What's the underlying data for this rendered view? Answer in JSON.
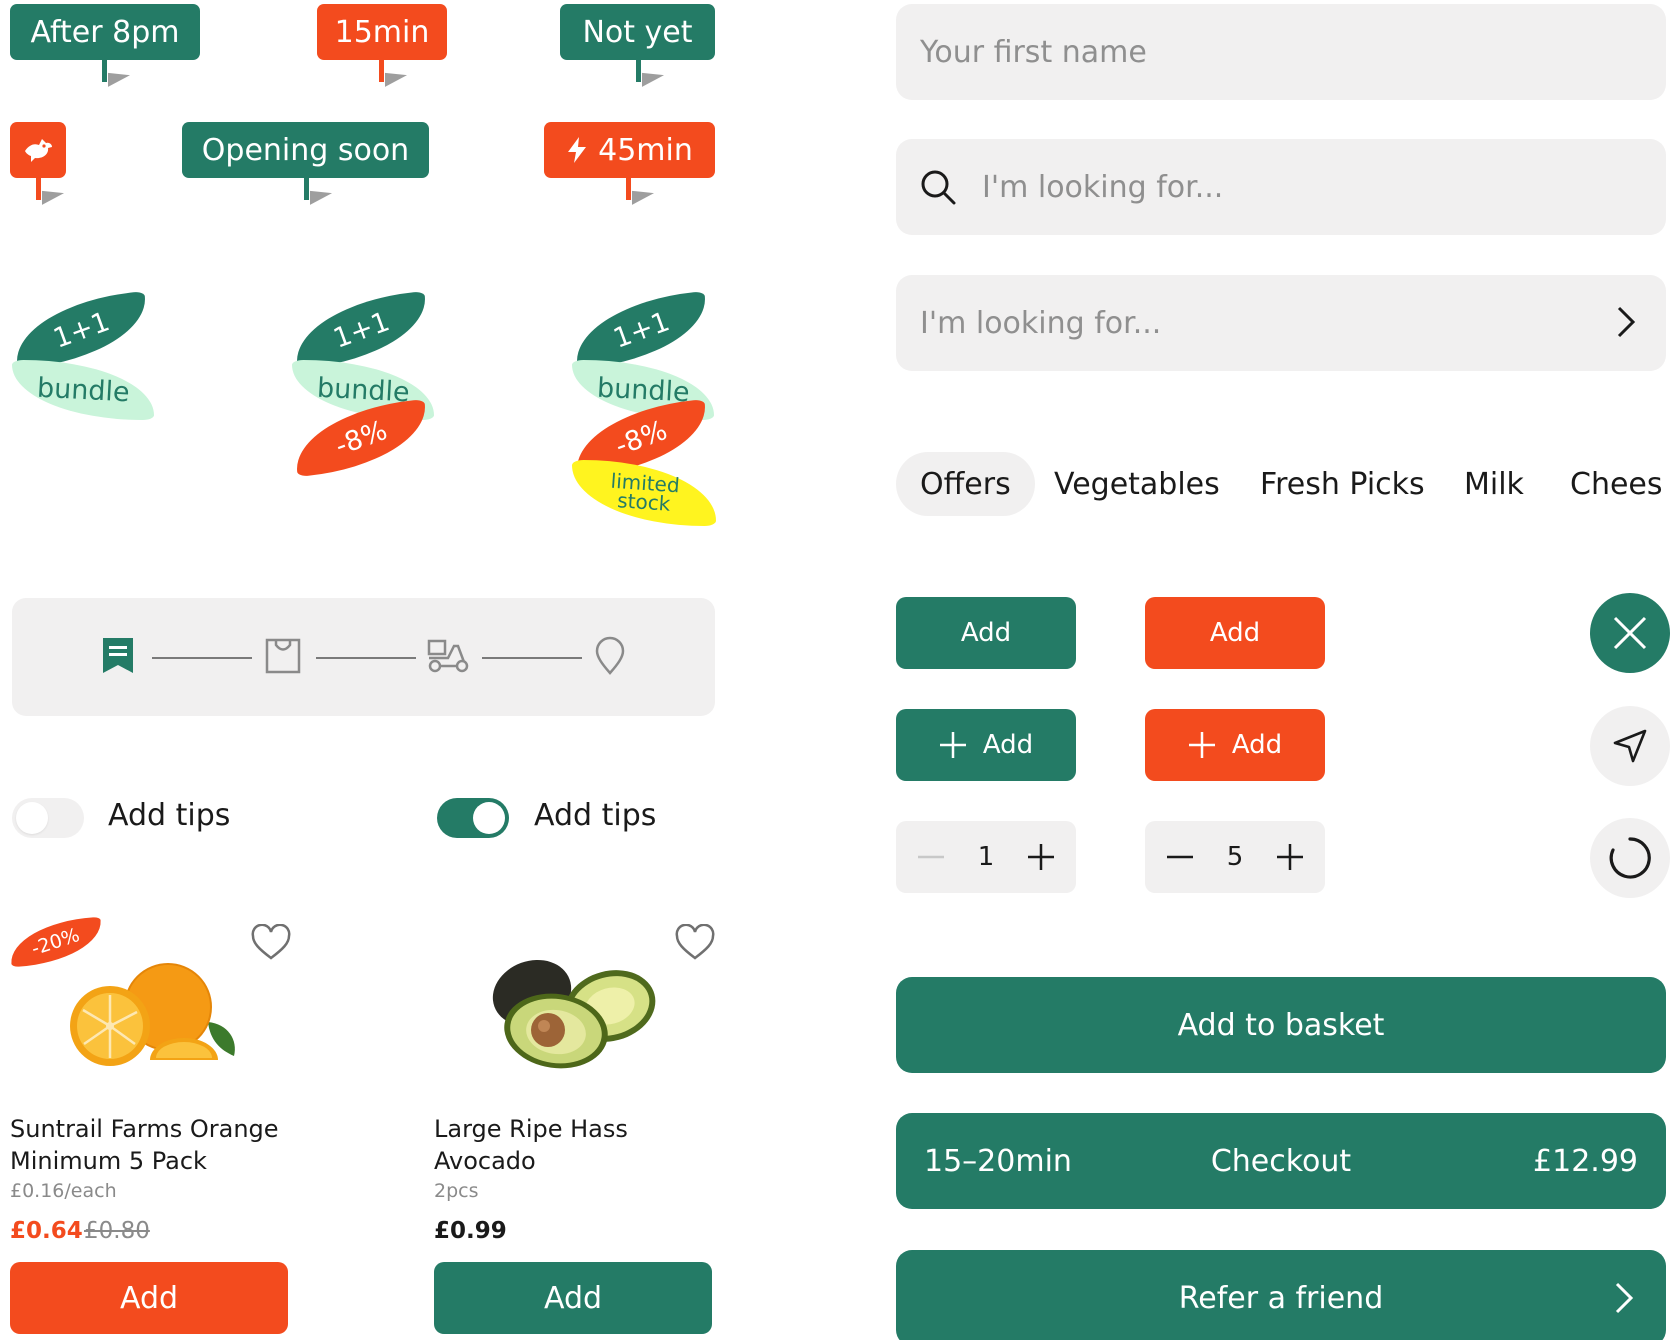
{
  "flags": {
    "after8": "After 8pm",
    "min15": "15min",
    "notyet": "Not yet",
    "opening": "Opening soon",
    "min45": "45min",
    "icon_bird": "bird-icon",
    "icon_bolt": "lightning-icon"
  },
  "badges": {
    "one_plus_one": "1+1",
    "bundle": "bundle",
    "discount": "-8%",
    "limited_line1": "limited",
    "limited_line2": "stock"
  },
  "tracker": {
    "steps": [
      "order-received-icon",
      "bag-icon",
      "scooter-icon",
      "location-pin-icon"
    ]
  },
  "toggles": {
    "off_label": "Add tips",
    "on_label": "Add tips",
    "off_state": false,
    "on_state": true
  },
  "products": [
    {
      "badge": "-20%",
      "name_line1": "Suntrail Farms Orange",
      "name_line2": "Minimum 5 Pack",
      "unit": "£0.16/each",
      "price": "£0.64",
      "old_price": "£0.80",
      "add_label": "Add",
      "image": "orange-image"
    },
    {
      "name_line1": "Large Ripe Hass",
      "name_line2": "Avocado",
      "unit": "2pcs",
      "price": "£0.99",
      "add_label": "Add",
      "image": "avocado-image"
    }
  ],
  "inputs": {
    "first_name_placeholder": "Your first name",
    "search_placeholder": "I'm looking for...",
    "search_nav_placeholder": "I'm looking for..."
  },
  "categories": [
    "Offers",
    "Vegetables",
    "Fresh Picks",
    "Milk",
    "Chees"
  ],
  "buttons": {
    "add": "Add",
    "add_orange": "Add",
    "add_plus": "Add",
    "add_plus_orange": "Add",
    "stepper1_value": "1",
    "stepper2_value": "5",
    "add_to_basket": "Add to basket",
    "checkout_time": "15–20min",
    "checkout_label": "Checkout",
    "checkout_total": "£12.99",
    "refer_friend": "Refer a friend"
  },
  "colors": {
    "primary_green": "#247b66",
    "accent_orange": "#f34b1e",
    "mint": "#c9f4da",
    "yellow": "#fff41f",
    "surface_grey": "#f1f0f0"
  }
}
